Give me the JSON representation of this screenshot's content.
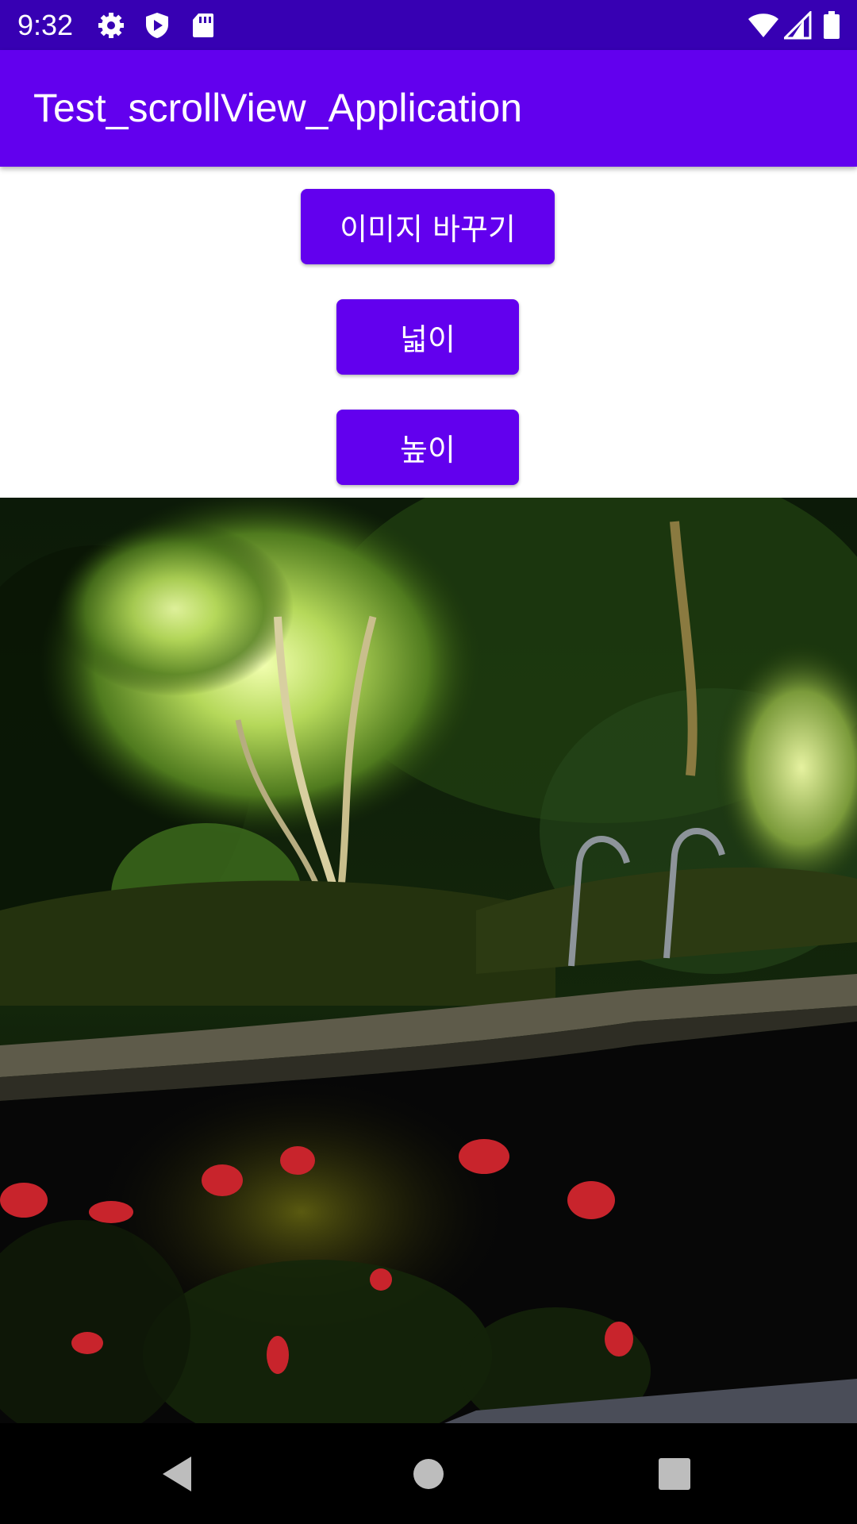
{
  "status_bar": {
    "time": "9:32",
    "icons_left": [
      "settings-icon",
      "play-protect-icon",
      "sd-card-icon"
    ],
    "icons_right": [
      "wifi-icon",
      "cell-signal-icon",
      "battery-icon"
    ]
  },
  "app_bar": {
    "title": "Test_scrollView_Application"
  },
  "buttons": {
    "change_image": "이미지 바꾸기",
    "width": "넓이",
    "height": "높이"
  },
  "content": {
    "image": "night-garden-pool-photo"
  },
  "nav_bar": {
    "buttons": [
      "back-icon",
      "home-icon",
      "recents-icon"
    ]
  },
  "colors": {
    "status_bar": "#3700b3",
    "primary": "#6200ee",
    "on_primary": "#ffffff",
    "nav_bar": "#000000"
  }
}
